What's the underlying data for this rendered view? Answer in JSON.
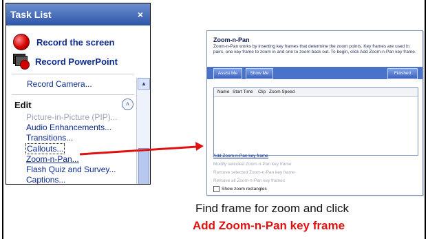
{
  "task_list": {
    "title": "Task List",
    "close": "×",
    "record_screen": "Record the screen",
    "record_powerpoint": "Record PowerPoint",
    "record_camera": "Record Camera...",
    "edit_heading": "Edit",
    "edit_items": [
      {
        "label": "Picture-in-Picture (PIP)...",
        "disabled": true
      },
      {
        "label": "Audio Enhancements...",
        "disabled": false
      },
      {
        "label": "Transitions...",
        "disabled": false
      },
      {
        "label": "Callouts...",
        "disabled": false
      },
      {
        "label": "Zoom-n-Pan...",
        "disabled": false
      },
      {
        "label": "Flash Quiz and Survey...",
        "disabled": false
      },
      {
        "label": "Captions...",
        "disabled": false
      }
    ]
  },
  "dialog": {
    "title": "Zoom-n-Pan",
    "description": "Zoom-n-Pan works by inserting key frames that determine the zoom points. Key frames are used in pairs, one key frame to zoom in and one to zoom back out. To begin, click Add Zoom-n-Pan key frame.",
    "assist_button": "Assist Me",
    "show_button": "Show Me",
    "finished_button": "Finished",
    "columns": [
      "Name",
      "Start Time",
      "Clip",
      "Zoom Speed"
    ],
    "add_link": "Add Zoom-n-Pan key frame",
    "modify_link": "Modify selected Zoom-n-Pan key frame",
    "remove_selected_link": "Remove selected Zoom-n-Pan key frame",
    "remove_all_link": "Remove all Zoom-n-Pan key frames",
    "show_rect_label": "Show zoom rectangles"
  },
  "caption": {
    "line1": "Find frame for zoom and click",
    "line2": "Add Zoom-n-Pan key frame"
  },
  "colors": {
    "accent": "#e01010",
    "link": "#0a2a8c",
    "header": "#2d55a8"
  }
}
